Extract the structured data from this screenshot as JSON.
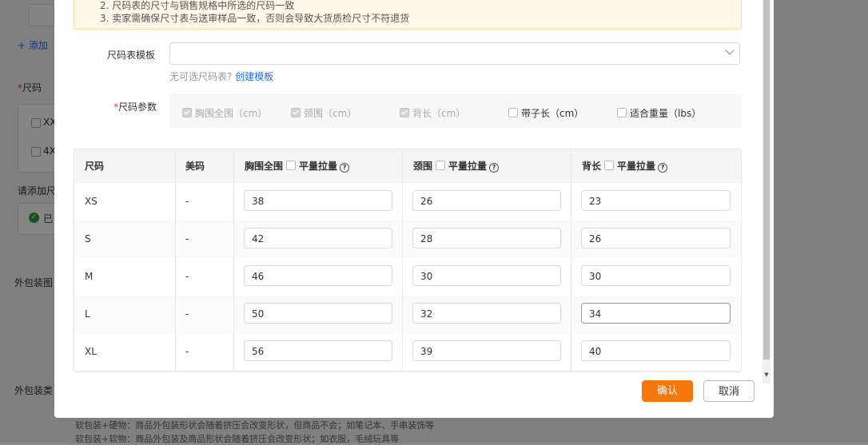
{
  "background": {
    "add_link": "+ 添加",
    "size_label": "尺码",
    "size_opt_1": "XX",
    "size_opt_2": "4X",
    "prompt": "请添加尺",
    "done": "已",
    "package_image": "外包装图",
    "package_type": "外包装类",
    "footnote_1": "软包装+硬物：商品外包装形状会随着挤压会改变形状，但商品不会；如笔记本、手串装饰等",
    "footnote_2": "软包装+软物：商品外包装及商品形状会随着挤压会改变形状；如衣服，毛绒玩具等"
  },
  "notice": {
    "line2": "2. 尺码表的尺寸与销售规格中所选的尺码一致",
    "line3": "3. 卖家需确保尺寸表与送审样品一致，否则会导致大货质检尺寸不符退货"
  },
  "template": {
    "label": "尺码表模板",
    "placeholder": "",
    "hint": "无可选尺码表?",
    "create_link": "创建模板"
  },
  "params": {
    "label": "尺码参数",
    "items": [
      {
        "label": "胸围全围（cm）",
        "checked": true
      },
      {
        "label": "颈围（cm）",
        "checked": true
      },
      {
        "label": "背长（cm）",
        "checked": true
      },
      {
        "label": "带子长（cm）",
        "checked": false
      },
      {
        "label": "适合重量（lbs）",
        "checked": false
      }
    ]
  },
  "table": {
    "headers": {
      "size": "尺码",
      "us_size": "美码",
      "chest": "胸围全围",
      "neck": "颈围",
      "back": "背长",
      "flat_stretch": "平量拉量",
      "help": "?"
    },
    "rows": [
      {
        "size": "XS",
        "us": "-",
        "chest": "38",
        "neck": "26",
        "back": "23"
      },
      {
        "size": "S",
        "us": "-",
        "chest": "42",
        "neck": "28",
        "back": "26"
      },
      {
        "size": "M",
        "us": "-",
        "chest": "46",
        "neck": "30",
        "back": "30"
      },
      {
        "size": "L",
        "us": "-",
        "chest": "50",
        "neck": "32",
        "back": "34"
      },
      {
        "size": "XL",
        "us": "-",
        "chest": "56",
        "neck": "39",
        "back": "40"
      }
    ]
  },
  "buttons": {
    "confirm": "确认",
    "cancel": "取消"
  },
  "colors": {
    "primary": "#f7770f",
    "link": "#1f6fdc",
    "required": "#e53935",
    "notice_bg": "#fff8e8"
  }
}
